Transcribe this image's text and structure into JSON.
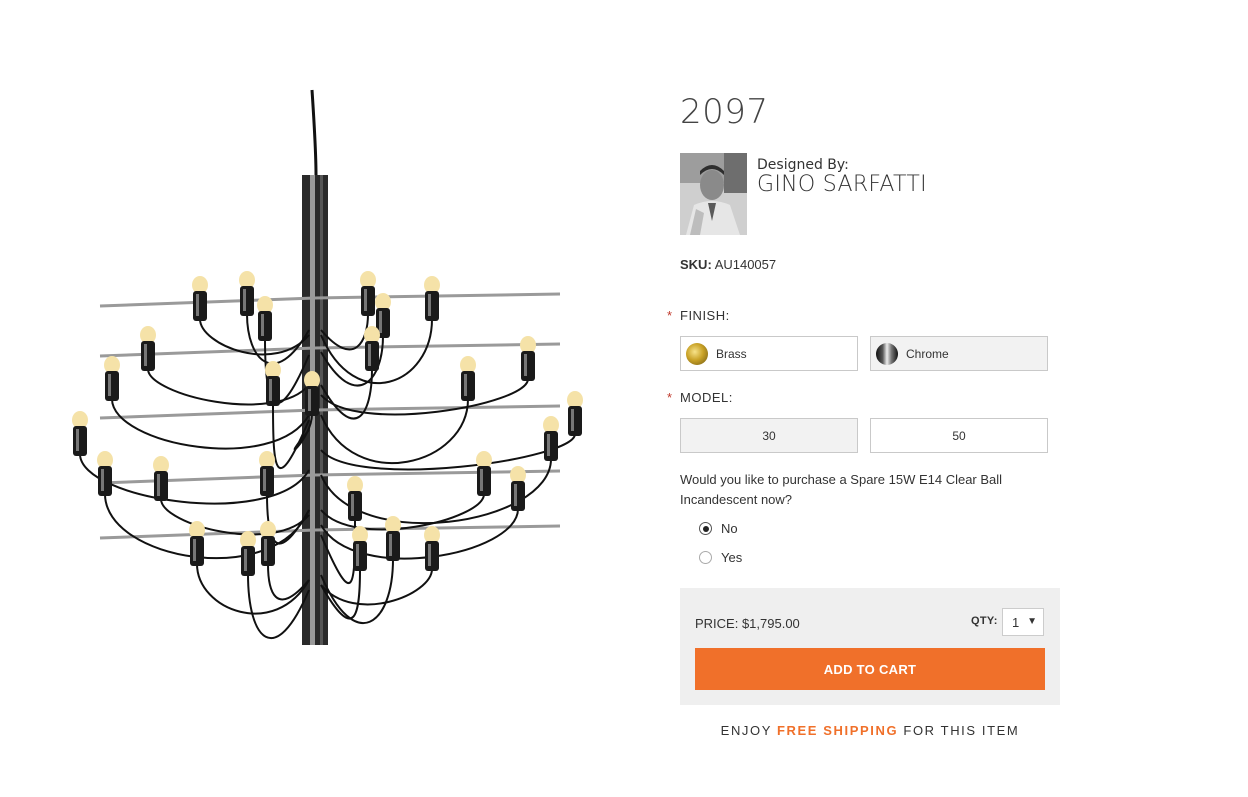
{
  "product": {
    "title": "2097",
    "designer_label": "Designed By:",
    "designer_name": "GINO SARFATTI",
    "sku_label": "SKU:",
    "sku_value": "AU140057"
  },
  "finish": {
    "required_mark": "*",
    "label": "FINISH:",
    "options": [
      {
        "label": "Brass",
        "swatch": "brass",
        "selected": false
      },
      {
        "label": "Chrome",
        "swatch": "chrome",
        "selected": true
      }
    ]
  },
  "model": {
    "required_mark": "*",
    "label": "MODEL:",
    "options": [
      {
        "label": "30",
        "selected": true
      },
      {
        "label": "50",
        "selected": false
      }
    ]
  },
  "spare": {
    "question": "Would you like to purchase a Spare 15W E14 Clear Ball Incandescent now?",
    "options": [
      {
        "label": "No",
        "checked": true
      },
      {
        "label": "Yes",
        "checked": false
      }
    ]
  },
  "purchase": {
    "price_text": "PRICE: $1,795.00",
    "qty_label": "QTY:",
    "qty_value": "1",
    "add_to_cart": "ADD TO CART"
  },
  "shipping": {
    "prefix": "ENJOY ",
    "highlight": "FREE SHIPPING",
    "suffix": " FOR THIS ITEM"
  },
  "colors": {
    "accent": "#f0702a",
    "required": "#c0392b",
    "buy_box_bg": "#efefef",
    "selected_option_bg": "#f2f2f2"
  }
}
